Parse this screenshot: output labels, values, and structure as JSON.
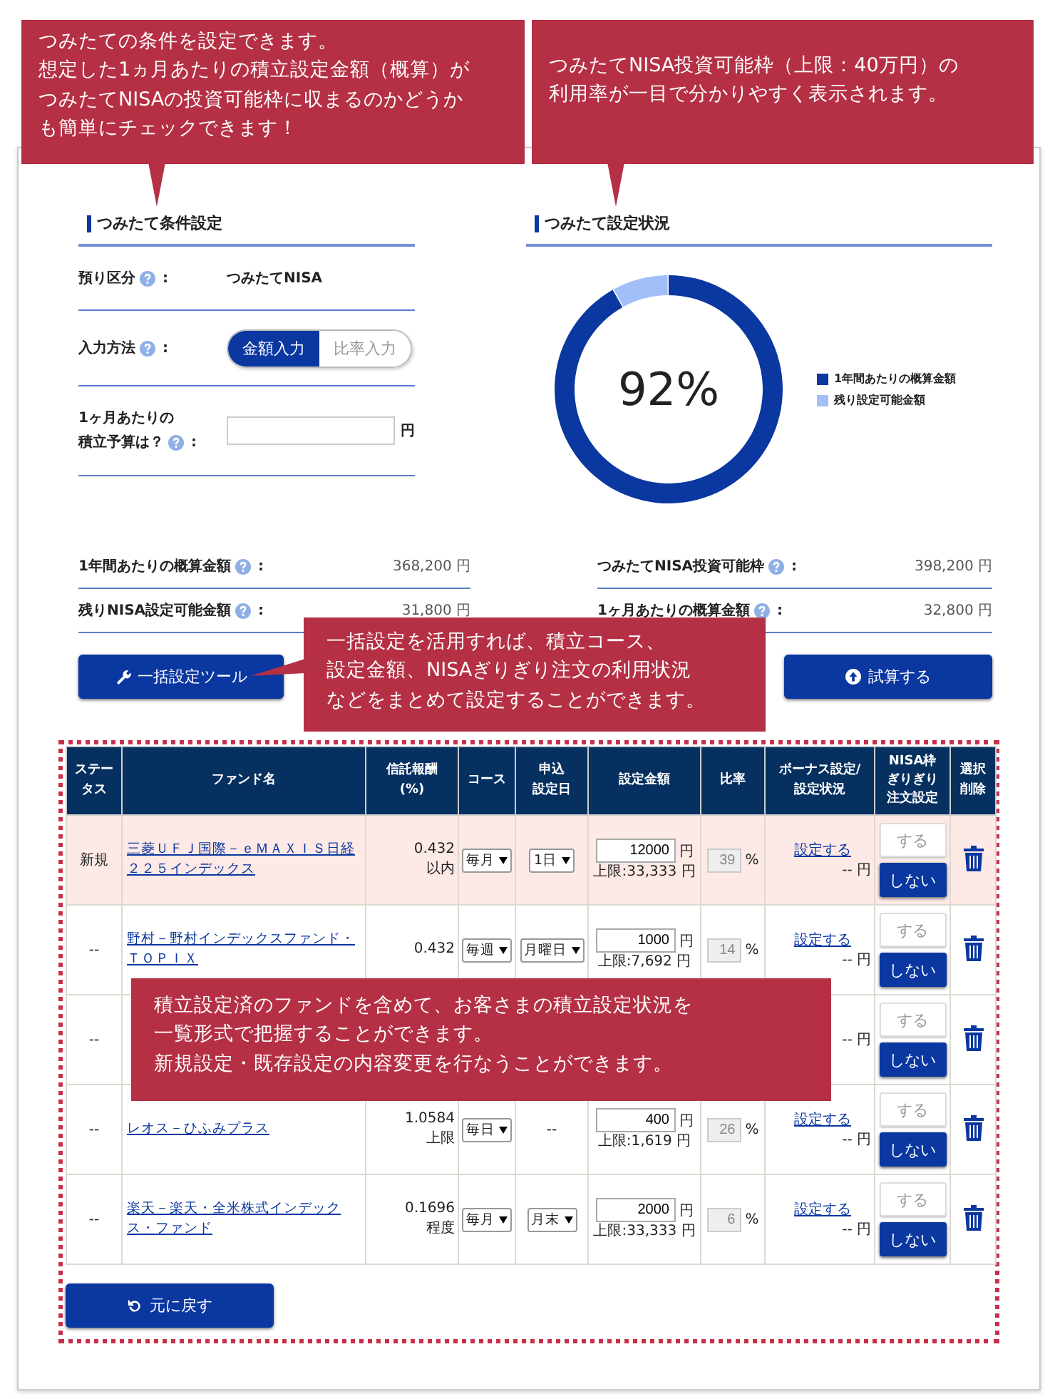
{
  "callouts": [
    {
      "lines": [
        "つみたての条件を設定できます。",
        "想定した1ヵ月あたりの積立設定金額（概算）が",
        "つみたてNISAの投資可能枠に収まるのかどうか",
        "も簡単にチェックできます！"
      ]
    },
    {
      "lines": [
        "つみたてNISA投資可能枠（上限：40万円）の",
        "利用率が一目で分かりやすく表示されます。"
      ]
    },
    {
      "lines": [
        "一括設定を活用すれば、積立コース、",
        "設定金額、NISAぎりぎり注文の利用状況",
        "などをまとめて設定することができます。"
      ]
    },
    {
      "lines": [
        "積立設定済のファンドを含めて、お客さまの積立設定状況を",
        "一覧形式で把握することができます。",
        "新規設定・既存設定の内容変更を行なうことができます。"
      ]
    }
  ],
  "conditions": {
    "title": "つみたて条件設定",
    "account_label": "預り区分",
    "account_colon": ":",
    "account_value": "つみたてNISA",
    "input_method_label": "入力方法",
    "input_method_colon": ":",
    "input_methods": [
      {
        "label": "金額入力",
        "selected": true
      },
      {
        "label": "比率入力",
        "selected": false
      }
    ],
    "budget_label": [
      "1ヶ月あたりの",
      "積立予算は？"
    ],
    "budget_colon": ":",
    "budget_unit": "円"
  },
  "status": {
    "title": "つみたて設定状況",
    "center_label": "92%",
    "chart_data": {
      "type": "donut",
      "categories": [
        "1年間あたりの概算金額",
        "残り設定可能金額"
      ],
      "values": [
        92,
        8
      ],
      "legend": "right"
    }
  },
  "summary": {
    "left": [
      {
        "label": "1年間あたりの概算金額",
        "colon": ":",
        "value": "368,200 円"
      },
      {
        "label": "残りNISA設定可能金額",
        "colon": ":",
        "value": "31,800 円"
      }
    ],
    "right": [
      {
        "label": "つみたてNISA投資可能枠",
        "colon": ":",
        "value": "398,200 円"
      },
      {
        "label": "1ヶ月あたりの概算金額",
        "colon": ":",
        "value": "32,800 円"
      }
    ]
  },
  "buttons": {
    "bulk_tool": "一括設定ツール",
    "simulate": "試算する",
    "reset": "元に戻す"
  },
  "table": {
    "columns": [
      [
        "ステー",
        "タス"
      ],
      [
        "ファンド名"
      ],
      [
        "信託報酬",
        "(%)"
      ],
      [
        "コース"
      ],
      [
        "申込",
        "設定日"
      ],
      [
        "設定金額"
      ],
      [
        "比率"
      ],
      [
        "ボーナス設定/",
        "設定状況"
      ],
      [
        "NISA枠",
        "ぎりぎり",
        "注文設定"
      ],
      [
        "選択",
        "削除"
      ]
    ],
    "rows": [
      {
        "highlighted": true,
        "status": "新規",
        "fund": "三菱ＵＦＪ国際－ｅＭＡＸＩＳ日経２２５インデックス",
        "fee": "0.432",
        "fee_note": "以内",
        "course": "毎月",
        "date": {
          "kind": "select",
          "value": "1日"
        },
        "amount": "12000",
        "amount_unit": "円",
        "limit": "上限:33,333 円",
        "ratio": "39",
        "ratio_unit": "%",
        "bonus_link": "設定する",
        "bonus_amount": "-- 円",
        "nisa_buttons": [
          {
            "label": "する",
            "selected": false
          },
          {
            "label": "しない",
            "selected": true
          }
        ]
      },
      {
        "highlighted": false,
        "status": "--",
        "fund": "野村－野村インデックスファンド・ＴＯＰＩＸ",
        "fee": "0.432",
        "course": "毎週",
        "date": {
          "kind": "select",
          "value": "月曜日"
        },
        "amount": "1000",
        "amount_unit": "円",
        "limit": "上限:7,692 円",
        "ratio": "14",
        "ratio_unit": "%",
        "bonus_link": "設定する",
        "bonus_amount": "-- 円",
        "nisa_buttons": [
          {
            "label": "する",
            "selected": false
          },
          {
            "label": "しない",
            "selected": true
          }
        ]
      },
      {
        "highlighted": false,
        "status": "--",
        "bonus_amount": "-- 円",
        "nisa_buttons": [
          {
            "label": "する",
            "selected": false
          },
          {
            "label": "しない",
            "selected": true
          }
        ]
      },
      {
        "highlighted": false,
        "status": "--",
        "fund": "レオス－ひふみプラス",
        "fee": "1.0584",
        "fee_note": "上限",
        "course": "毎日",
        "date": {
          "kind": "text",
          "value": "--"
        },
        "amount": "400",
        "amount_unit": "円",
        "limit": "上限:1,619 円",
        "ratio": "26",
        "ratio_unit": "%",
        "bonus_link": "設定する",
        "bonus_amount": "-- 円",
        "nisa_buttons": [
          {
            "label": "する",
            "selected": false
          },
          {
            "label": "しない",
            "selected": true
          }
        ]
      },
      {
        "highlighted": false,
        "status": "--",
        "fund": "楽天－楽天・全米株式インデックス・ファンド",
        "fee": "0.1696",
        "fee_note": "程度",
        "course": "毎月",
        "date": {
          "kind": "select",
          "value": "月末"
        },
        "amount": "2000",
        "amount_unit": "円",
        "limit": "上限:33,333 円",
        "ratio": "6",
        "ratio_unit": "%",
        "bonus_link": "設定する",
        "bonus_amount": "-- 円",
        "nisa_buttons": [
          {
            "label": "する",
            "selected": false
          },
          {
            "label": "しない",
            "selected": true
          }
        ]
      }
    ]
  }
}
